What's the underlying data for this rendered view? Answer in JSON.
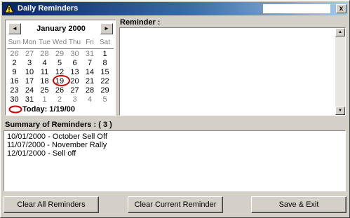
{
  "window": {
    "title": "Daily Reminders",
    "close_label": "x",
    "icon": "warning-icon"
  },
  "calendar": {
    "prev_label": "◄",
    "next_label": "►",
    "month": "January 2000",
    "weekdays": [
      "Sun",
      "Mon",
      "Tue",
      "Wed",
      "Thu",
      "Fri",
      "Sat"
    ],
    "weeks": [
      [
        "26",
        "27",
        "28",
        "29",
        "30",
        "31",
        "1"
      ],
      [
        "2",
        "3",
        "4",
        "5",
        "6",
        "7",
        "8"
      ],
      [
        "9",
        "10",
        "11",
        "12",
        "13",
        "14",
        "15"
      ],
      [
        "16",
        "17",
        "18",
        "19",
        "20",
        "21",
        "22"
      ],
      [
        "23",
        "24",
        "25",
        "26",
        "27",
        "28",
        "29"
      ],
      [
        "30",
        "31",
        "1",
        "2",
        "3",
        "4",
        "5"
      ]
    ],
    "today_label": "Today: 1/19/00",
    "today_circle_color": "#d00000"
  },
  "reminder": {
    "label": "Reminder :",
    "value": ""
  },
  "summary": {
    "label": "Summary of Reminders : ( 3 )",
    "items": [
      "10/01/2000 - October Sell Off",
      "11/07/2000 - November Rally",
      "12/01/2000 - Sell off"
    ]
  },
  "buttons": {
    "clear_all": "Clear All Reminders",
    "clear_current": "Clear Current Reminder",
    "save_exit": "Save & Exit"
  }
}
